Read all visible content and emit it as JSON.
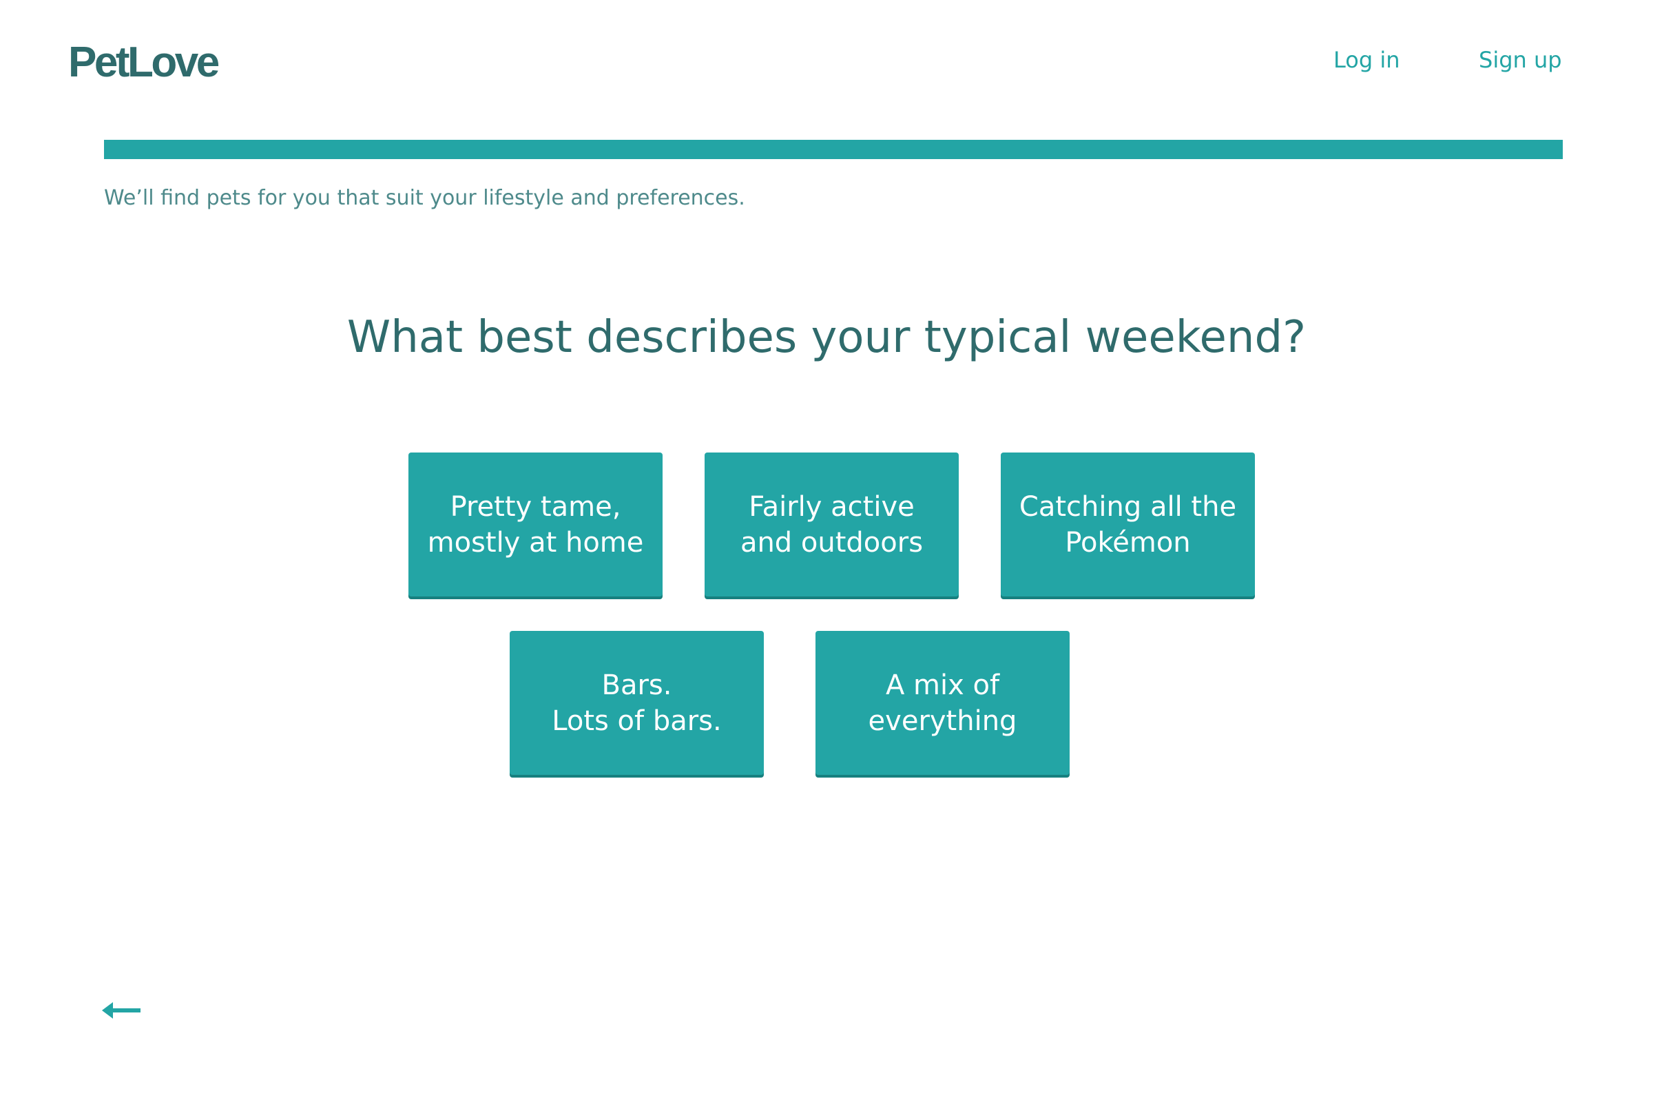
{
  "header": {
    "logo": "PetLove",
    "login_label": "Log in",
    "signup_label": "Sign up"
  },
  "progress": {
    "fraction": 1.0
  },
  "subtitle": "We’ll find pets for you that suit your lifestyle and preferences.",
  "question": "What best describes your typical weekend?",
  "options": [
    {
      "line1": "Pretty tame,",
      "line2": "mostly at home"
    },
    {
      "line1": "Fairly active",
      "line2": "and outdoors"
    },
    {
      "line1": "Catching all the",
      "line2": "Pokémon"
    },
    {
      "line1": "Bars.",
      "line2": "Lots of bars."
    },
    {
      "line1": "A mix of",
      "line2": "everything"
    }
  ],
  "icons": {
    "back": "arrow-left-icon"
  },
  "colors": {
    "accent": "#23a5a5",
    "accent_dark": "#17807f",
    "heading": "#2f6b6c",
    "subtitle": "#4e8a8b",
    "background": "#ffffff"
  }
}
